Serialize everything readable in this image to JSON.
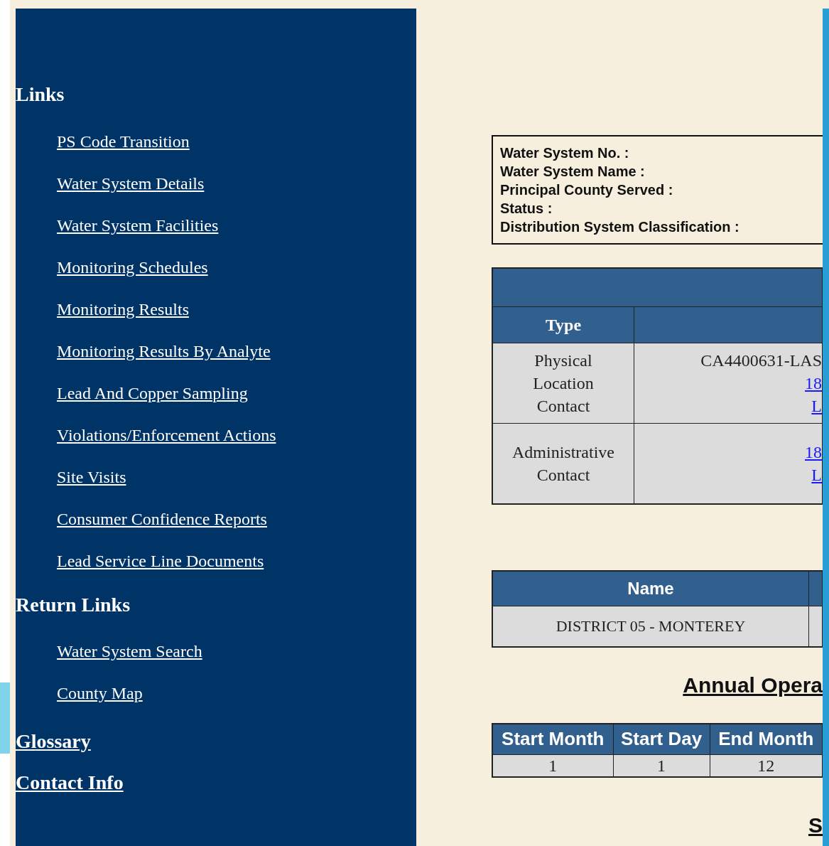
{
  "sidebar": {
    "sections": [
      {
        "heading": "Links",
        "kind": "plain",
        "links": [
          "PS Code Transition",
          "Water System Details",
          "Water System Facilities",
          "Monitoring Schedules",
          "Monitoring Results",
          "Monitoring Results By Analyte",
          "Lead And Copper Sampling",
          "Violations/Enforcement Actions",
          "Site Visits",
          "Consumer Confidence Reports",
          "Lead Service Line Documents"
        ]
      },
      {
        "heading": "Return Links",
        "kind": "plain",
        "links": [
          "Water System Search",
          "County Map"
        ]
      },
      {
        "heading": "Glossary",
        "kind": "link"
      },
      {
        "heading": "Contact Info",
        "kind": "link"
      }
    ]
  },
  "info_box": {
    "labels": [
      "Water System No. :",
      "Water System Name :",
      "Principal County Served :",
      "Status :",
      "Distribution System Classification :"
    ]
  },
  "contacts_table": {
    "columns": [
      "Type"
    ],
    "rows": [
      {
        "type": [
          "Physical",
          "Location",
          "Contact"
        ],
        "lines": [
          {
            "kind": "text",
            "text": "CA4400631-LAS"
          },
          {
            "kind": "link",
            "text": "18"
          },
          {
            "kind": "link",
            "text": "L"
          }
        ]
      },
      {
        "type": [
          "Administrative",
          "Contact"
        ],
        "lines": [
          {
            "kind": "link",
            "text": "18"
          },
          {
            "kind": "link",
            "text": "L"
          }
        ]
      }
    ]
  },
  "district_table": {
    "columns": [
      "Name"
    ],
    "rows": [
      [
        "DISTRICT 05 - MONTEREY"
      ]
    ]
  },
  "annual_heading": "Annual Opera",
  "schedule_table": {
    "columns": [
      "Start Month",
      "Start Day",
      "End Month"
    ],
    "rows": [
      [
        "1",
        "1",
        "12"
      ]
    ]
  },
  "bottom_heading": "S"
}
